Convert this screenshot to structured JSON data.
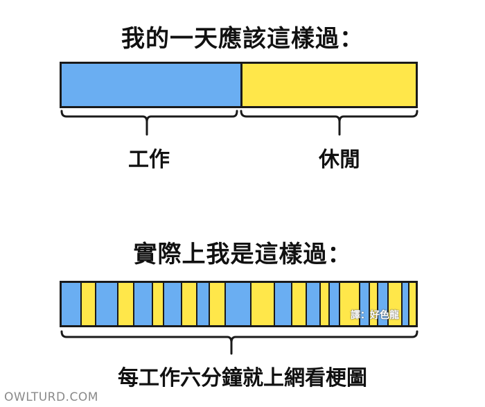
{
  "top_panel": {
    "title": "我的一天應該這樣過：",
    "work_label": "工作",
    "rest_label": "休閒",
    "work_color": "#6aaef2",
    "rest_color": "#ffe74a"
  },
  "bottom_panel": {
    "title": "實際上我是這樣過：",
    "caption": "每工作六分鐘就上網看梗圖",
    "stripes": [
      "blue",
      "yellow",
      "blue",
      "yellow",
      "blue",
      "yellow",
      "blue",
      "yellow",
      "blue",
      "yellow",
      "blue",
      "yellow",
      "blue",
      "yellow",
      "blue",
      "yellow",
      "blue",
      "yellow",
      "blue"
    ],
    "stripe_weights": [
      34,
      24,
      38,
      26,
      32,
      18,
      30,
      25,
      21,
      26,
      44,
      41,
      29,
      24,
      22,
      14,
      16,
      34,
      16,
      13,
      16,
      22,
      10,
      12
    ]
  },
  "watermark": "譯：好色龍",
  "credit": "OWLTURD.COM"
}
